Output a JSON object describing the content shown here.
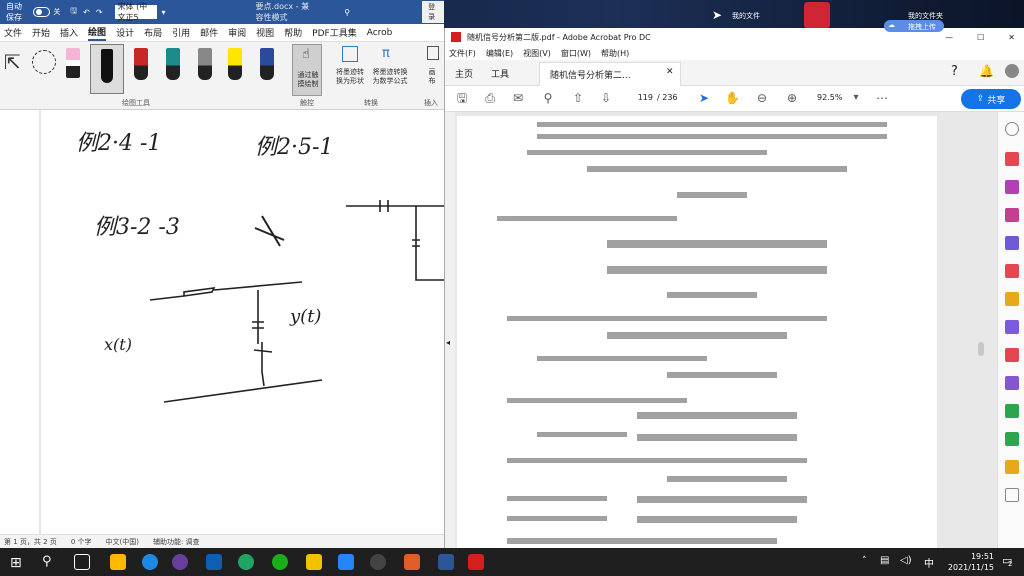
{
  "word": {
    "autosave_label": "自动保存",
    "autosave_state": "关",
    "font_name": "宋体 (中文正5",
    "doc_title": "要点.docx  -  兼容性模式",
    "login_label": "登录",
    "tabs": [
      "文件",
      "开始",
      "插入",
      "绘图",
      "设计",
      "布局",
      "引用",
      "邮件",
      "审阅",
      "视图",
      "帮助",
      "PDF工具集",
      "Acrob"
    ],
    "ribbon": {
      "group_draw_tools": "绘图工具",
      "group_touch": "触控",
      "group_convert": "转换",
      "group_insert": "插入",
      "btn_touch_draw": "通过触\n摸绘制",
      "btn_ink_to_shape": "将墨迹转\n换为形状",
      "btn_ink_to_math": "将墨迹转换\n为数学公式",
      "btn_insert": "画\n布"
    },
    "status": {
      "page": "第 1 页，共 2 页",
      "words": "0 个字",
      "lang": "中文(中国)",
      "accessibility": "辅助功能: 调查"
    }
  },
  "acrobat": {
    "title": "随机信号分析第二版.pdf - Adobe Acrobat Pro DC",
    "menu": [
      "文件(F)",
      "编辑(E)",
      "视图(V)",
      "窗口(W)",
      "帮助(H)"
    ],
    "tab_home": "主页",
    "tab_tools": "工具",
    "doc_tab": "随机信号分析第二...",
    "page_current": "119",
    "page_total": "/ 236",
    "zoom": "92.5%",
    "share_label": "共享"
  },
  "desktop": {
    "my_files_1": "我的文件",
    "my_files_2": "我的文件夹",
    "upload_label": "拖拽上传"
  },
  "taskbar": {
    "time": "19:51",
    "date": "2021/11/15",
    "notif_count": "2"
  },
  "handwriting": {
    "label1": "例2·4 -1",
    "label2": "例2·5-1",
    "label3": "例3-2 -3",
    "x_label": "x(t)",
    "y_label": "y(t)"
  },
  "colors": {
    "word_blue": "#2b579a",
    "acrobat_red": "#d71e1e",
    "share_blue": "#1473e6"
  }
}
